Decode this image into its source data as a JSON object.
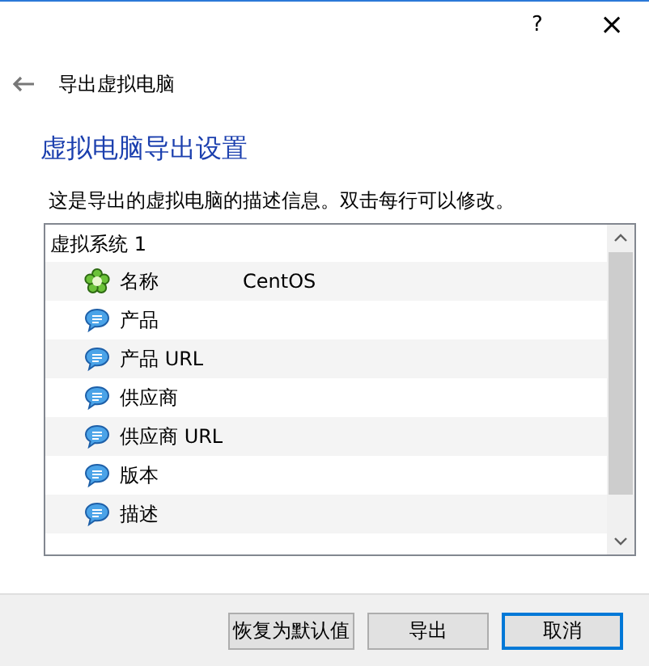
{
  "title_bar": {
    "help": "?",
    "close": "×"
  },
  "nav": {
    "title": "导出虚拟电脑"
  },
  "heading": "虚拟电脑导出设置",
  "description": "这是导出的虚拟电脑的描述信息。双击每行可以修改。",
  "tree": {
    "group": "虚拟系统 1",
    "items": [
      {
        "kind": "name",
        "label": "名称",
        "value": "CentOS"
      },
      {
        "kind": "text",
        "label": "产品"
      },
      {
        "kind": "text",
        "label": "产品 URL"
      },
      {
        "kind": "text",
        "label": "供应商"
      },
      {
        "kind": "text",
        "label": "供应商 URL"
      },
      {
        "kind": "text",
        "label": "版本"
      },
      {
        "kind": "text",
        "label": "描述"
      }
    ]
  },
  "buttons": [
    {
      "label": "恢复为默认值",
      "default": false
    },
    {
      "label": "导出",
      "default": false
    },
    {
      "label": "取消",
      "default": true
    }
  ]
}
